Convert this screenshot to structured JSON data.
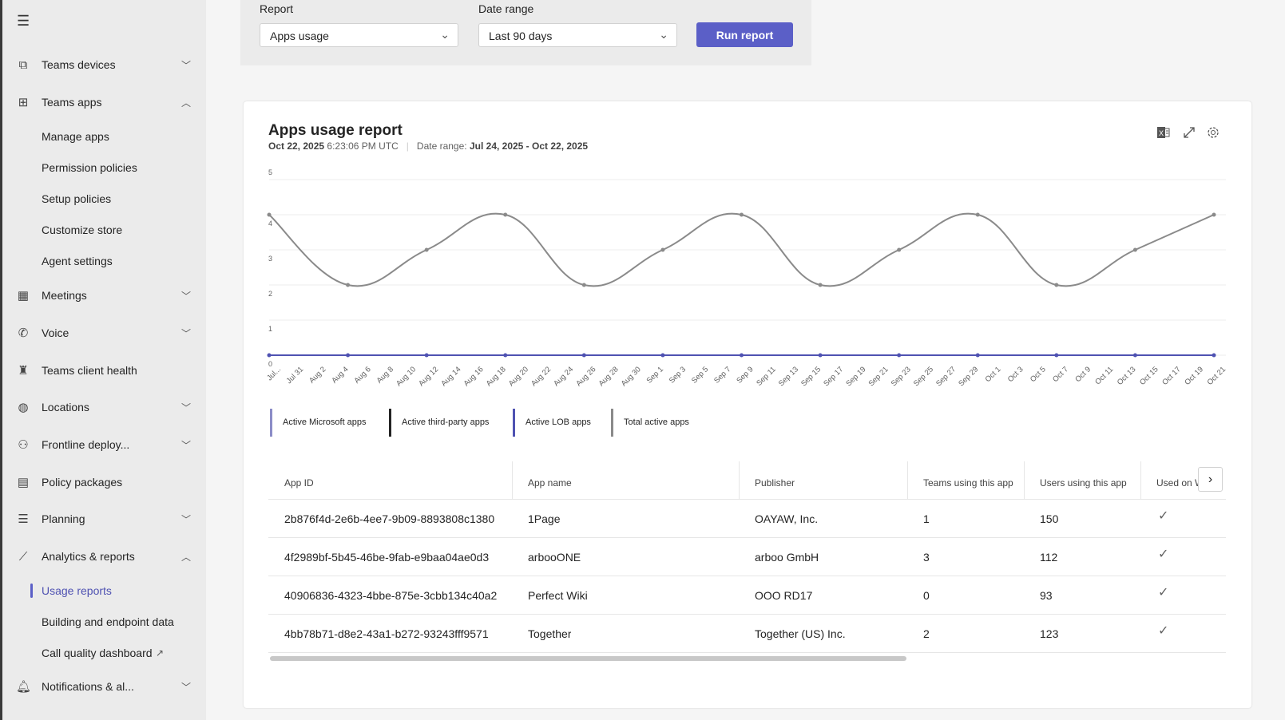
{
  "sidebar": {
    "items": [
      {
        "label": "Teams devices",
        "icon": "devices-icon",
        "chevron": "down",
        "top": 61
      },
      {
        "label": "Teams apps",
        "icon": "apps-icon",
        "chevron": "up",
        "top": 108
      },
      {
        "label": "Manage apps",
        "sub": true,
        "top": 151
      },
      {
        "label": "Permission policies",
        "sub": true,
        "top": 190
      },
      {
        "label": "Setup policies",
        "sub": true,
        "top": 229
      },
      {
        "label": "Customize store",
        "sub": true,
        "top": 268
      },
      {
        "label": "Agent settings",
        "sub": true,
        "top": 307
      },
      {
        "label": "Meetings",
        "icon": "calendar-icon",
        "chevron": "down",
        "top": 350
      },
      {
        "label": "Voice",
        "icon": "phone-icon",
        "chevron": "down",
        "top": 397
      },
      {
        "label": "Teams client health",
        "icon": "teams-icon",
        "top": 444
      },
      {
        "label": "Locations",
        "icon": "globe-icon",
        "chevron": "down",
        "top": 490
      },
      {
        "label": "Frontline deploy...",
        "icon": "people-icon",
        "chevron": "down",
        "top": 537
      },
      {
        "label": "Policy packages",
        "icon": "package-icon",
        "top": 584
      },
      {
        "label": "Planning",
        "icon": "list-icon",
        "chevron": "down",
        "top": 630
      },
      {
        "label": "Analytics & reports",
        "icon": "chart-icon",
        "chevron": "up",
        "top": 677
      },
      {
        "label": "Usage reports",
        "sub": true,
        "active": true,
        "top": 720
      },
      {
        "label": "Building and endpoint data",
        "sub": true,
        "top": 759
      },
      {
        "label": "Call quality dashboard",
        "sub": true,
        "external": true,
        "top": 798
      },
      {
        "label": "Notifications & al...",
        "icon": "bell-icon",
        "chevron": "down",
        "top": 840
      }
    ]
  },
  "filters": {
    "report_label": "Report",
    "report_value": "Apps usage",
    "range_label": "Date range",
    "range_value": "Last 90 days",
    "run_label": "Run report"
  },
  "report": {
    "title": "Apps usage report",
    "date": "Oct 22, 2025",
    "time": "6:23:06 PM UTC",
    "range_label": "Date range:",
    "range_value": "Jul 24, 2025 - Oct 22, 2025"
  },
  "chart_data": {
    "type": "line",
    "ylim": [
      0,
      5
    ],
    "yticks": [
      0,
      1,
      2,
      3,
      4,
      5
    ],
    "xticks": [
      "Jul...",
      "Jul 31",
      "Aug 2",
      "Aug 4",
      "Aug 6",
      "Aug 8",
      "Aug 10",
      "Aug 12",
      "Aug 14",
      "Aug 16",
      "Aug 18",
      "Aug 20",
      "Aug 22",
      "Aug 24",
      "Aug 26",
      "Aug 28",
      "Aug 30",
      "Sep 1",
      "Sep 3",
      "Sep 5",
      "Sep 7",
      "Sep 9",
      "Sep 11",
      "Sep 13",
      "Sep 15",
      "Sep 17",
      "Sep 19",
      "Sep 21",
      "Sep 23",
      "Sep 25",
      "Sep 27",
      "Sep 29",
      "Oct 1",
      "Oct 3",
      "Oct 5",
      "Oct 7",
      "Oct 9",
      "Oct 11",
      "Oct 13",
      "Oct 15",
      "Oct 17",
      "Oct 19",
      "Oct 21"
    ],
    "x": [
      "Jul 28",
      "Aug 4",
      "Aug 11",
      "Aug 18",
      "Aug 25",
      "Sep 1",
      "Sep 8",
      "Sep 15",
      "Sep 22",
      "Sep 29",
      "Oct 6",
      "Oct 13",
      "Oct 20"
    ],
    "series": [
      {
        "name": "Active Microsoft apps",
        "color": "#8b8cc7",
        "values": null
      },
      {
        "name": "Active third-party apps",
        "color": "#242424",
        "values": null
      },
      {
        "name": "Active LOB apps",
        "color": "#4f52b2",
        "values": [
          0,
          0,
          0,
          0,
          0,
          0,
          0,
          0,
          0,
          0,
          0,
          0,
          0
        ]
      },
      {
        "name": "Total active apps",
        "color": "#8a8a8a",
        "values": [
          4,
          2,
          3,
          4,
          2,
          3,
          4,
          2,
          3,
          4,
          2,
          3,
          4
        ]
      }
    ],
    "grid": true,
    "legend": "bottom"
  },
  "table": {
    "columns": [
      "App ID",
      "App name",
      "Publisher",
      "Teams using this app",
      "Users using this app",
      "Used on W..."
    ],
    "rows": [
      [
        "2b876f4d-2e6b-4ee7-9b09-8893808c1380",
        "1Page",
        "OAYAW, Inc.",
        "1",
        "150",
        "✓"
      ],
      [
        "4f2989bf-5b45-46be-9fab-e9baa04ae0d3",
        "arbooONE",
        "arboo GmbH",
        "3",
        "112",
        "✓"
      ],
      [
        "40906836-4323-4bbe-875e-3cbb134c40a2",
        "Perfect Wiki",
        "OOO RD17",
        "0",
        "93",
        "✓"
      ],
      [
        "4bb78b71-d8e2-43a1-b272-93243fff9571",
        "Together",
        "Together (US) Inc.",
        "2",
        "123",
        "✓"
      ]
    ]
  }
}
